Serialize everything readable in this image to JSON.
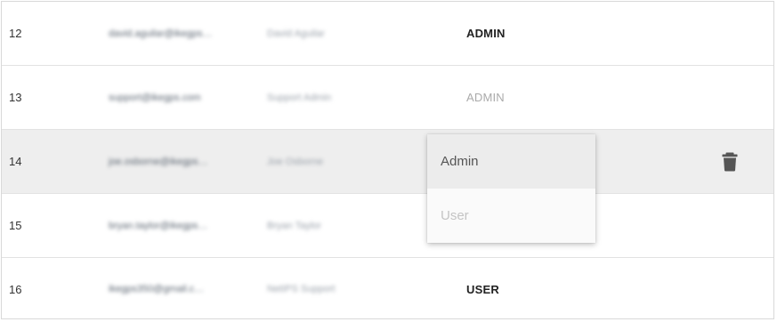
{
  "rows": [
    {
      "id": "12",
      "email": "david.aguilar@ikegps…",
      "name": "David Aguilar",
      "role": "ADMIN"
    },
    {
      "id": "13",
      "email": "support@ikegps.com",
      "name": "Support Admin",
      "role": "ADMIN"
    },
    {
      "id": "14",
      "email": "joe.osborne@ikegps…",
      "name": "Joe Osborne",
      "role": ""
    },
    {
      "id": "15",
      "email": "bryan.taylor@ikegps…",
      "name": "Bryan Taylor",
      "role": ""
    },
    {
      "id": "16",
      "email": "ikegps350@gmail.c…",
      "name": "NetIPS Support",
      "role": "USER"
    }
  ],
  "role_dropdown": {
    "options": [
      "Admin",
      "User"
    ],
    "selected": "Admin"
  },
  "icons": {
    "delete": "trash-icon"
  },
  "colors": {
    "selected_row": "#eeeeee",
    "delete_icon": "#555555"
  }
}
